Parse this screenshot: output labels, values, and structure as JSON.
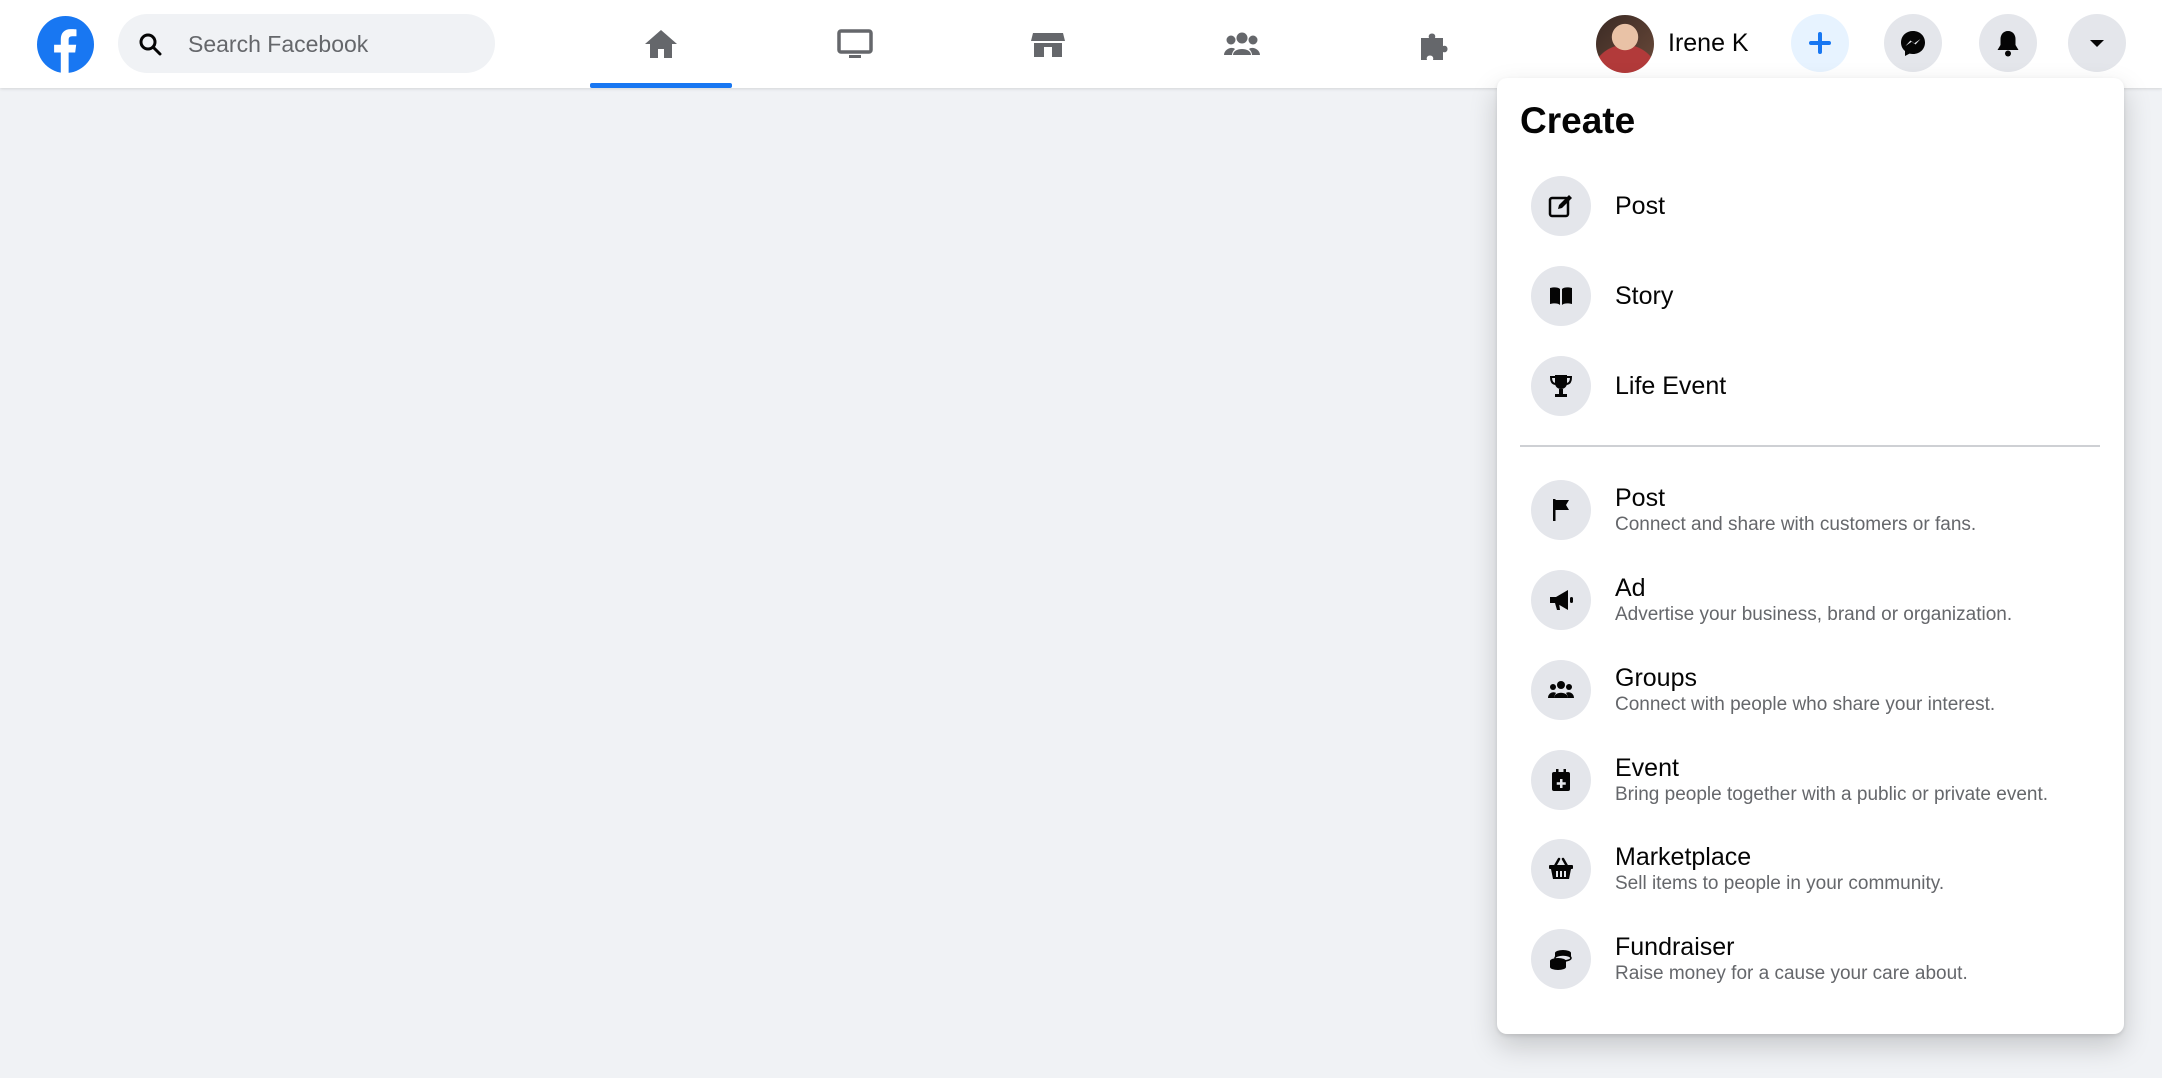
{
  "colors": {
    "brand": "#1877f2",
    "icon_gray": "#65676b",
    "background": "#f0f2f5"
  },
  "search": {
    "placeholder": "Search Facebook",
    "icon": "search-icon"
  },
  "nav": {
    "tabs": [
      {
        "name": "home",
        "icon": "home-icon",
        "active": true
      },
      {
        "name": "watch",
        "icon": "monitor-icon",
        "active": false
      },
      {
        "name": "marketplace",
        "icon": "store-icon",
        "active": false
      },
      {
        "name": "groups",
        "icon": "people-icon",
        "active": false
      },
      {
        "name": "gaming",
        "icon": "puzzle-icon",
        "active": false
      }
    ]
  },
  "profile": {
    "name": "Irene K"
  },
  "actions": [
    {
      "name": "create",
      "icon": "plus-icon",
      "active": true
    },
    {
      "name": "messenger",
      "icon": "messenger-icon"
    },
    {
      "name": "notifications",
      "icon": "bell-icon"
    },
    {
      "name": "account",
      "icon": "caret-down-icon"
    }
  ],
  "create_menu": {
    "title": "Create",
    "primary": [
      {
        "label": "Post",
        "icon": "edit-icon"
      },
      {
        "label": "Story",
        "icon": "book-icon"
      },
      {
        "label": "Life Event",
        "icon": "trophy-icon"
      }
    ],
    "secondary": [
      {
        "label": "Post",
        "description": "Connect and share with customers or fans.",
        "icon": "flag-icon"
      },
      {
        "label": "Ad",
        "description": "Advertise your business, brand or organization.",
        "icon": "megaphone-icon"
      },
      {
        "label": "Groups",
        "description": "Connect with people who share your interest.",
        "icon": "people-icon"
      },
      {
        "label": "Event",
        "description": "Bring people together with a public or private event.",
        "icon": "calendar-plus-icon"
      },
      {
        "label": "Marketplace",
        "description": "Sell items to people in your community.",
        "icon": "basket-icon"
      },
      {
        "label": "Fundraiser",
        "description": "Raise money for a cause your care about.",
        "icon": "coins-icon"
      }
    ]
  }
}
